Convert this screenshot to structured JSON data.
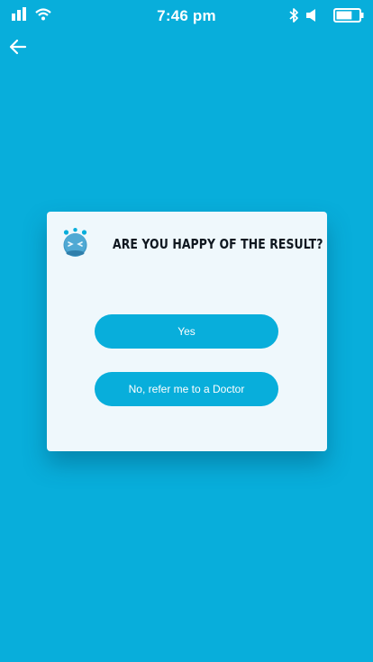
{
  "status_bar": {
    "time": "7:46 pm",
    "signal_icon": "signal-bars-icon",
    "wifi_icon": "wifi-icon",
    "bluetooth_icon": "bluetooth-icon",
    "volume_icon": "speaker-icon",
    "battery_icon": "battery-icon",
    "battery_level": 0.7
  },
  "nav": {
    "back_icon": "arrow-left-icon"
  },
  "dialog": {
    "mascot_icon": "mascot-icon",
    "title": "ARE YOU HAPPY OF THE RESULT?",
    "yes_label": "Yes",
    "no_label": "No, refer me to a Doctor"
  },
  "colors": {
    "background": "#08aedb",
    "dialog_bg": "#eff8fc",
    "button": "#08aedb",
    "title_text": "#101820"
  }
}
